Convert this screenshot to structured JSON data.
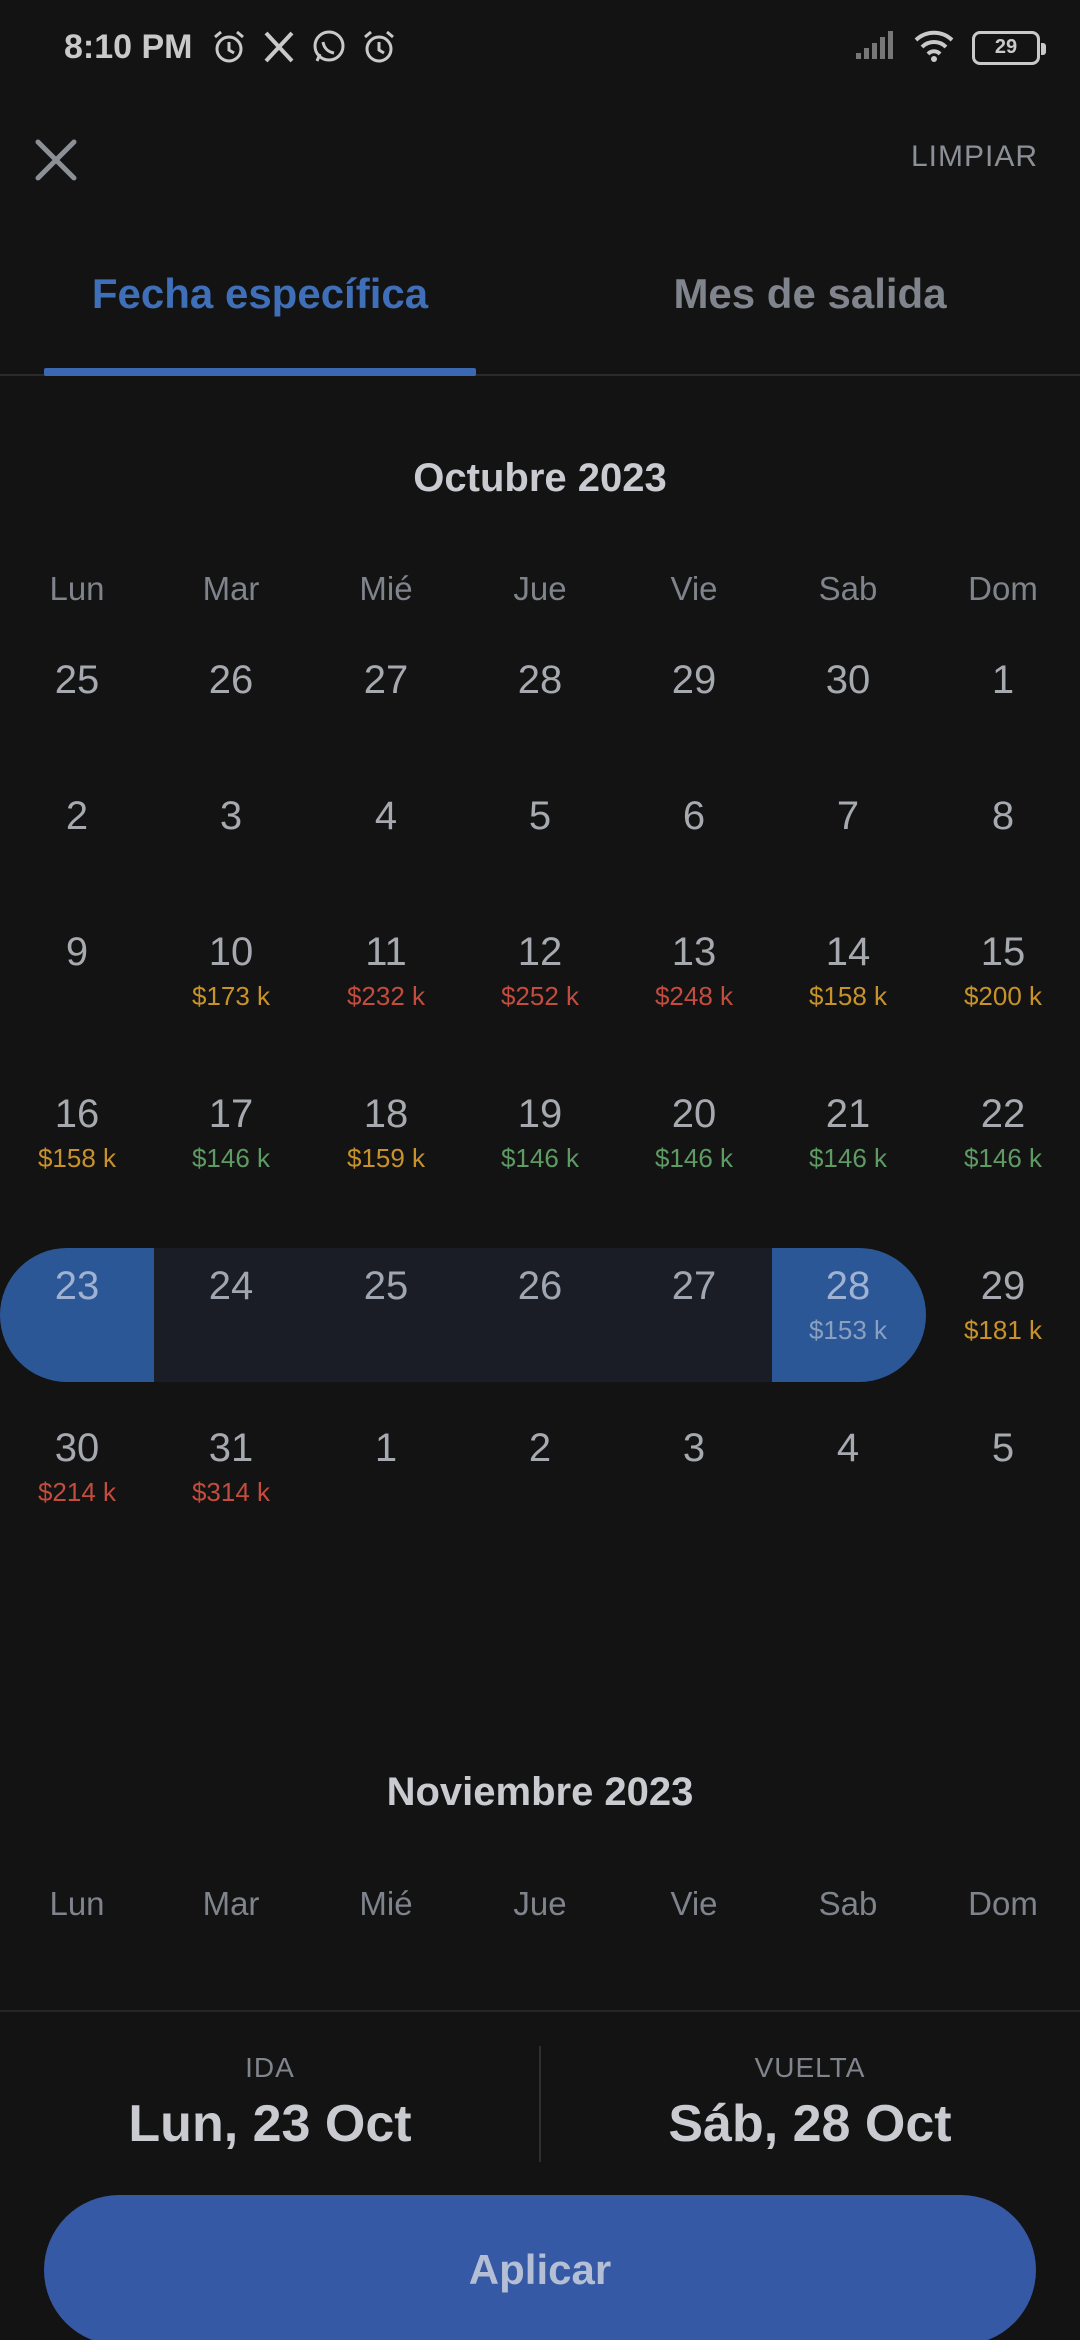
{
  "status_bar": {
    "time": "8:10 PM",
    "battery": "29",
    "left_icons": [
      "alarm-icon",
      "x-logo-icon",
      "whatsapp-icon",
      "alarm-icon"
    ],
    "right_icons": [
      "signal-icon",
      "wifi-icon",
      "battery-icon"
    ]
  },
  "top_bar": {
    "close_icon": "close-icon",
    "clear_label": "LIMPIAR"
  },
  "tabs": [
    {
      "label": "Fecha específica",
      "active": true
    },
    {
      "label": "Mes de salida",
      "active": false
    }
  ],
  "weekdays": [
    "Lun",
    "Mar",
    "Mié",
    "Jue",
    "Vie",
    "Sab",
    "Dom"
  ],
  "months": [
    {
      "title": "Octubre 2023",
      "weeks": [
        [
          {
            "d": "25"
          },
          {
            "d": "26"
          },
          {
            "d": "27"
          },
          {
            "d": "28"
          },
          {
            "d": "29"
          },
          {
            "d": "30"
          },
          {
            "d": "1"
          }
        ],
        [
          {
            "d": "2"
          },
          {
            "d": "3"
          },
          {
            "d": "4"
          },
          {
            "d": "5"
          },
          {
            "d": "6"
          },
          {
            "d": "7"
          },
          {
            "d": "8"
          }
        ],
        [
          {
            "d": "9"
          },
          {
            "d": "10",
            "p": "$173 k",
            "c": "orange"
          },
          {
            "d": "11",
            "p": "$232 k",
            "c": "red"
          },
          {
            "d": "12",
            "p": "$252 k",
            "c": "red"
          },
          {
            "d": "13",
            "p": "$248 k",
            "c": "red"
          },
          {
            "d": "14",
            "p": "$158 k",
            "c": "orange"
          },
          {
            "d": "15",
            "p": "$200 k",
            "c": "orange"
          }
        ],
        [
          {
            "d": "16",
            "p": "$158 k",
            "c": "orange"
          },
          {
            "d": "17",
            "p": "$146 k",
            "c": "green"
          },
          {
            "d": "18",
            "p": "$159 k",
            "c": "orange"
          },
          {
            "d": "19",
            "p": "$146 k",
            "c": "green"
          },
          {
            "d": "20",
            "p": "$146 k",
            "c": "green"
          },
          {
            "d": "21",
            "p": "$146 k",
            "c": "green"
          },
          {
            "d": "22",
            "p": "$146 k",
            "c": "green"
          }
        ],
        [
          {
            "d": "23",
            "s": "sel"
          },
          {
            "d": "24",
            "s": "range"
          },
          {
            "d": "25",
            "s": "range"
          },
          {
            "d": "26",
            "s": "range"
          },
          {
            "d": "27",
            "s": "range"
          },
          {
            "d": "28",
            "p": "$153 k",
            "s": "sel"
          },
          {
            "d": "29",
            "p": "$181 k",
            "c": "orange"
          }
        ],
        [
          {
            "d": "30",
            "p": "$214 k",
            "c": "red"
          },
          {
            "d": "31",
            "p": "$314 k",
            "c": "red"
          },
          {
            "d": "1"
          },
          {
            "d": "2"
          },
          {
            "d": "3"
          },
          {
            "d": "4"
          },
          {
            "d": "5"
          }
        ]
      ]
    },
    {
      "title": "Noviembre 2023"
    }
  ],
  "colors": {
    "accent": "#3c67b1",
    "price_orange": "#c8922b",
    "price_red": "#c24c3e",
    "price_green": "#5e9a63"
  },
  "bottom": {
    "departure_label": "IDA",
    "departure_value": "Lun, 23 Oct",
    "return_label": "VUELTA",
    "return_value": "Sáb, 28 Oct",
    "apply_label": "Aplicar"
  }
}
